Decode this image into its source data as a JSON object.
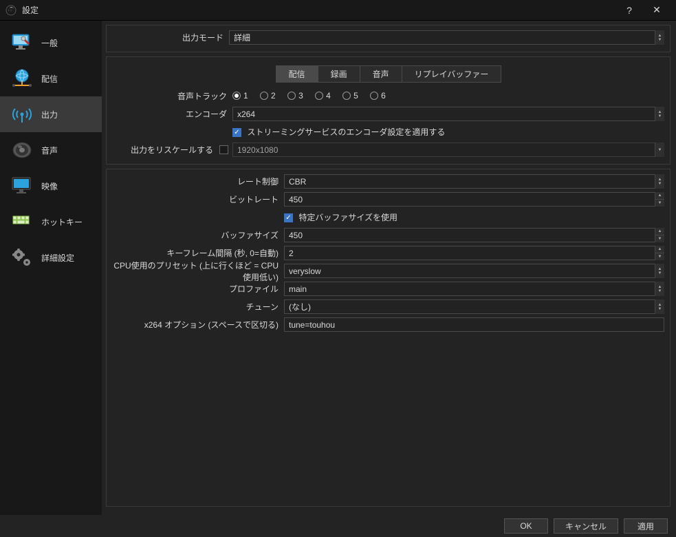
{
  "window": {
    "title": "設定"
  },
  "sidebar": {
    "items": [
      {
        "label": "一般"
      },
      {
        "label": "配信"
      },
      {
        "label": "出力"
      },
      {
        "label": "音声"
      },
      {
        "label": "映像"
      },
      {
        "label": "ホットキー"
      },
      {
        "label": "詳細設定"
      }
    ],
    "selected_index": 2
  },
  "output_mode": {
    "label": "出力モード",
    "value": "詳細"
  },
  "tabs": {
    "items": [
      {
        "label": "配信"
      },
      {
        "label": "録画"
      },
      {
        "label": "音声"
      },
      {
        "label": "リプレイバッファー"
      }
    ],
    "active_index": 0
  },
  "stream": {
    "audio_tracks_label": "音声トラック",
    "audio_tracks": [
      "1",
      "2",
      "3",
      "4",
      "5",
      "6"
    ],
    "audio_track_selected": 0,
    "encoder_label": "エンコーダ",
    "encoder": "x264",
    "apply_service_label": "ストリーミングサービスのエンコーダ設定を適用する",
    "apply_service_checked": true,
    "rescale_label": "出力をリスケールする",
    "rescale_checked": false,
    "rescale_value": "1920x1080"
  },
  "encoder_settings": {
    "rate_control_label": "レート制御",
    "rate_control": "CBR",
    "bitrate_label": "ビットレート",
    "bitrate": "450",
    "custom_buffer_label": "特定バッファサイズを使用",
    "custom_buffer_checked": true,
    "buffer_label": "バッファサイズ",
    "buffer": "450",
    "keyint_label": "キーフレーム間隔 (秒, 0=自動)",
    "keyint": "2",
    "preset_label": "CPU使用のプリセット (上に行くほど = CPU使用低い)",
    "preset": "veryslow",
    "profile_label": "プロファイル",
    "profile": "main",
    "tune_label": "チューン",
    "tune": "(なし)",
    "x264opts_label": "x264 オプション (スペースで区切る)",
    "x264opts": "tune=touhou"
  },
  "footer": {
    "ok": "OK",
    "cancel": "キャンセル",
    "apply": "適用"
  }
}
